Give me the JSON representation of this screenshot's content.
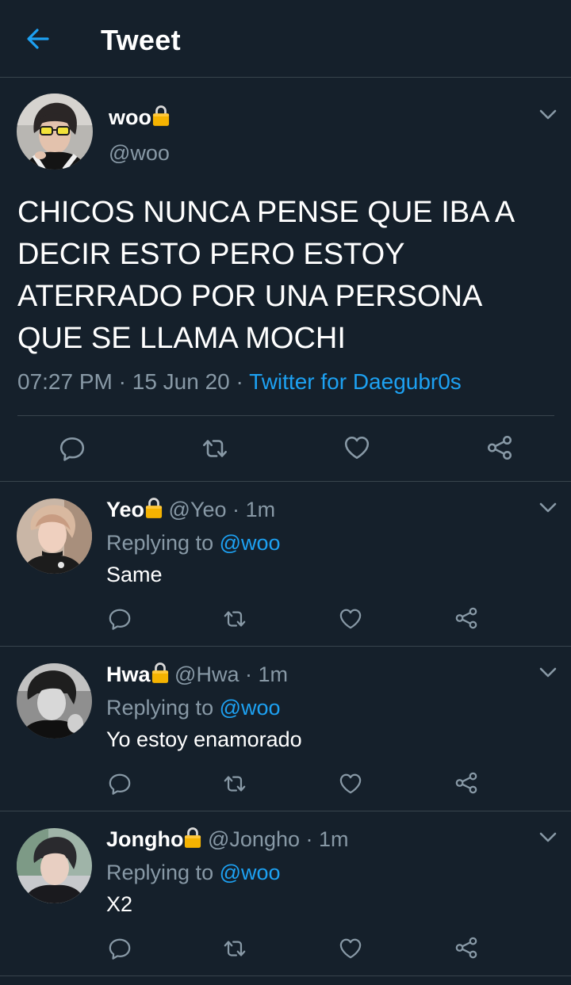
{
  "header": {
    "title": "Tweet"
  },
  "tweet": {
    "name": "woo",
    "handle": "@woo",
    "text": "CHICOS NUNCA PENSE QUE IBA A DECIR ESTO PERO ESTOY ATERRADO POR UNA PERSONA QUE SE LLAMA MOCHI",
    "time": "07:27 PM",
    "sep": "·",
    "date": "15 Jun 20",
    "source": "Twitter for Daegubr0s"
  },
  "replies": [
    {
      "name": "Yeo",
      "handle": "@Yeo",
      "time": "1m",
      "replying_prefix": "Replying to",
      "replying_to": "@woo",
      "text": "Same"
    },
    {
      "name": "Hwa",
      "handle": "@Hwa",
      "time": "1m",
      "replying_prefix": "Replying to",
      "replying_to": "@woo",
      "text": "Yo estoy enamorado"
    },
    {
      "name": "Jongho",
      "handle": "@Jongho",
      "time": "1m",
      "replying_prefix": "Replying to",
      "replying_to": "@woo",
      "text": "X2"
    }
  ],
  "icons": {
    "back": "arrow-left-icon",
    "chevron": "chevron-down-icon",
    "lock": "lock-icon",
    "reply": "comment-icon",
    "retweet": "retweet-icon",
    "like": "heart-icon",
    "share": "share-icon"
  },
  "colors": {
    "background": "#15202b",
    "accent": "#1da1f2",
    "secondary_text": "#8899a6",
    "divider": "#38444d",
    "lock": "#f5b301"
  }
}
